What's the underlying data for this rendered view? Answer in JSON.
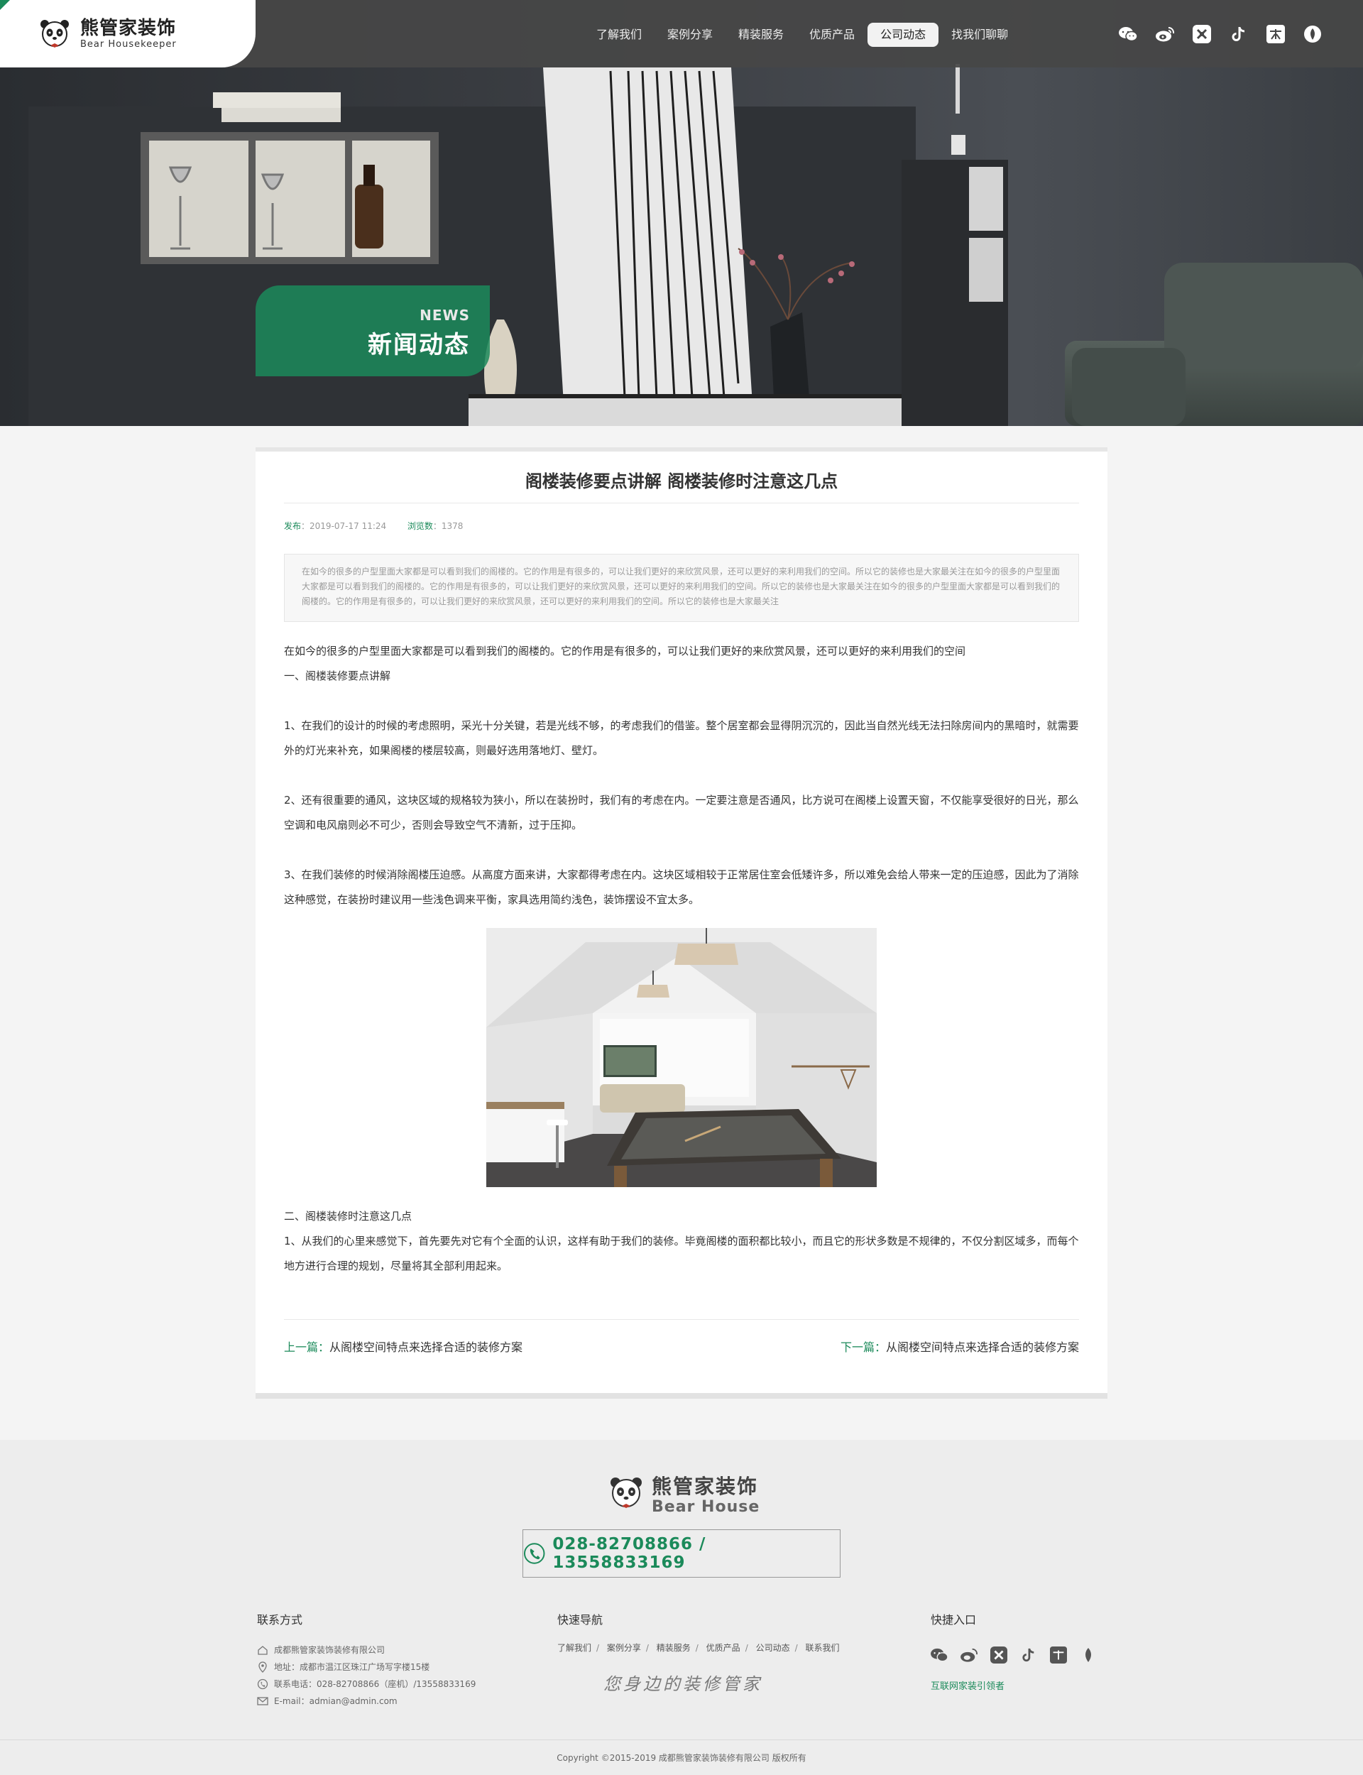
{
  "header": {
    "brand_cn": "熊管家装饰",
    "brand_en": "Bear Housekeeper",
    "nav": [
      {
        "label": "了解我们"
      },
      {
        "label": "案例分享"
      },
      {
        "label": "精装服务"
      },
      {
        "label": "优质产品"
      },
      {
        "label": "公司动态",
        "active": true
      },
      {
        "label": "找我们聊聊"
      }
    ],
    "social_icons": [
      "wechat-icon",
      "weibo-icon",
      "meituan-icon",
      "douyin-icon",
      "zhihu-icon",
      "fire-icon"
    ]
  },
  "hero": {
    "badge_en": "NEWS",
    "badge_cn": "新闻动态"
  },
  "article": {
    "title": "阁楼装修要点讲解 阁楼装修时注意这几点",
    "meta": {
      "publish_label": "发布",
      "publish_time": "2019-07-17 11:24",
      "views_label": "浏览数",
      "views": "1378"
    },
    "summary": "在如今的很多的户型里面大家都是可以看到我们的阁楼的。它的作用是有很多的，可以让我们更好的来欣赏风景，还可以更好的来利用我们的空间。所以它的装修也是大家最关注在如今的很多的户型里面大家都是可以看到我们的阁楼的。它的作用是有很多的，可以让我们更好的来欣赏风景，还可以更好的来利用我们的空间。所以它的装修也是大家最关注在如今的很多的户型里面大家都是可以看到我们的阁楼的。它的作用是有很多的，可以让我们更好的来欣赏风景，还可以更好的来利用我们的空间。所以它的装修也是大家最关注",
    "intro": "在如今的很多的户型里面大家都是可以看到我们的阁楼的。它的作用是有很多的，可以让我们更好的来欣赏风景，还可以更好的来利用我们的空间",
    "heading1": "一、阁楼装修要点讲解",
    "p1": "1、在我们的设计的时候的考虑照明，采光十分关键，若是光线不够，的考虑我们的借鉴。整个居室都会显得阴沉沉的，因此当自然光线无法扫除房间内的黑暗时，就需要外的灯光来补充，如果阁楼的楼层较高，则最好选用落地灯、壁灯。",
    "p2": "2、还有很重要的通风，这块区域的规格较为狭小，所以在装扮时，我们有的考虑在内。一定要注意是否通风，比方说可在阁楼上设置天窗，不仅能享受很好的日光，那么空调和电风扇则必不可少，否则会导致空气不清新，过于压抑。",
    "p3": "3、在我们装修的时候消除阁楼压迫感。从高度方面来讲，大家都得考虑在内。这块区域相较于正常居住室会低矮许多，所以难免会给人带来一定的压迫感，因此为了消除这种感觉，在装扮时建议用一些浅色调来平衡，家具选用简约浅色，装饰摆设不宜太多。",
    "heading2": "二、阁楼装修时注意这几点",
    "p4": "1、从我们的心里来感觉下，首先要先对它有个全面的认识，这样有助于我们的装修。毕竟阁楼的面积都比较小，而且它的形状多数是不规律的，不仅分割区域多，而每个地方进行合理的规划，尽量将其全部利用起来。",
    "prev_label": "上一篇：",
    "prev_title": "从阁楼空间特点来选择合适的装修方案",
    "next_label": "下一篇：",
    "next_title": "从阁楼空间特点来选择合适的装修方案"
  },
  "footer": {
    "brand_cn": "熊管家装饰",
    "brand_en": "Bear House",
    "phone": "028-82708866 / 13558833169",
    "contact_title": "联系方式",
    "company": "成都熊管家装饰装修有限公司",
    "address": "地址：成都市温江区珠江广场写字楼15楼",
    "tel": "联系电话：028-82708866（座机）/13558833169",
    "email": "E-mail：admian@admin.com",
    "quick_title": "快速导航",
    "quick_links": [
      "了解我们",
      "案例分享",
      "精装服务",
      "优质产品",
      "公司动态",
      "联系我们"
    ],
    "slogan": "您身边的装修管家",
    "entry_title": "快捷入口",
    "entry_link": "互联网家装引领者",
    "copyright": "Copyright ©2015-2019  成都熊管家装饰装修有限公司 版权所有"
  },
  "colors": {
    "accent": "#1b8a5a",
    "header_bg": "#464646",
    "footer_bg": "#ededed"
  }
}
